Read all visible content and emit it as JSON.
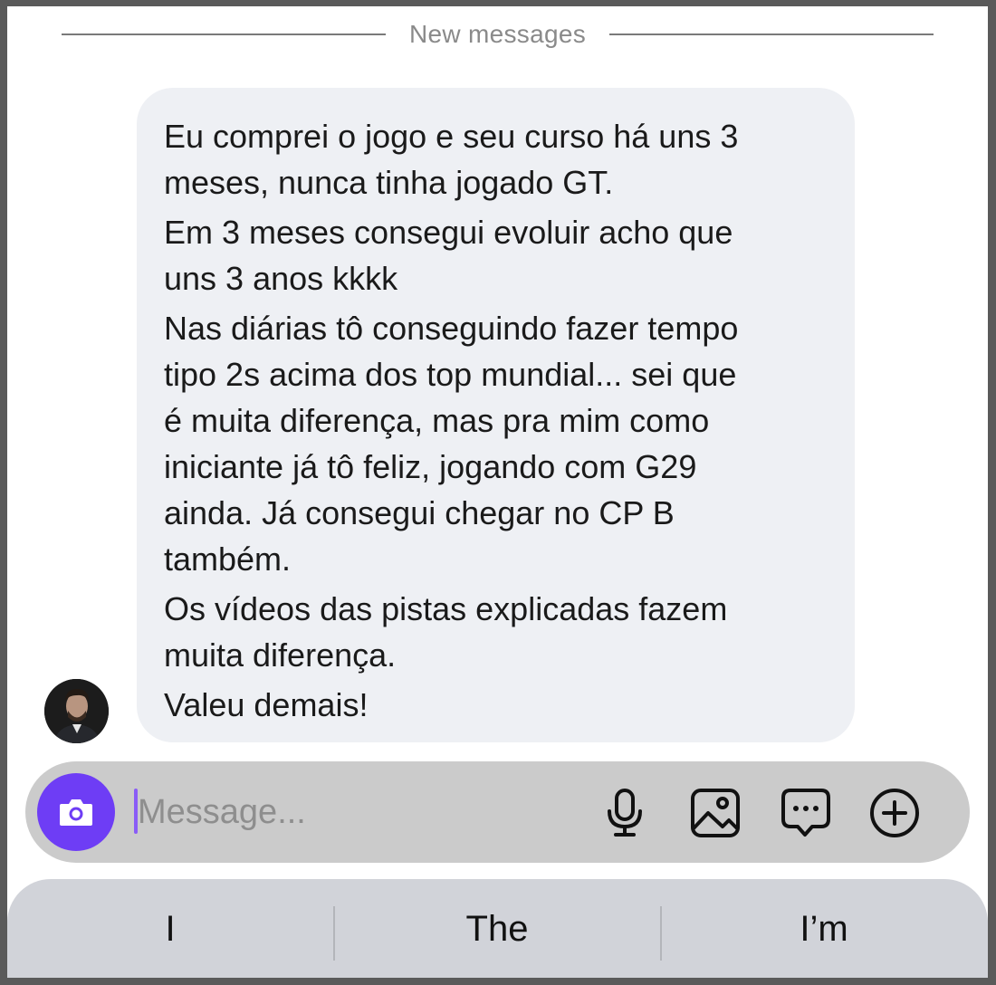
{
  "divider": {
    "label": "New messages"
  },
  "message": {
    "paragraphs": [
      "Eu comprei o jogo e seu curso há uns 3\nmeses, nunca tinha jogado GT.",
      "Em 3 meses consegui evoluir acho que\nuns 3 anos kkkk",
      "Nas diárias tô conseguindo fazer tempo\ntipo 2s acima dos top mundial... sei que\né muita diferença, mas pra mim como\niniciante já tô feliz, jogando com G29\nainda. Já consegui chegar no CP B\ntambém.",
      "Os vídeos das pistas explicadas fazem\nmuita diferença.",
      "Valeu demais!"
    ]
  },
  "composer": {
    "placeholder": "Message...",
    "icons": [
      "camera-icon",
      "microphone-icon",
      "gallery-icon",
      "chat-bubble-icon",
      "plus-circle-icon"
    ],
    "accent_color": "#6e3df5"
  },
  "suggestions": [
    "I",
    "The",
    "I’m"
  ]
}
